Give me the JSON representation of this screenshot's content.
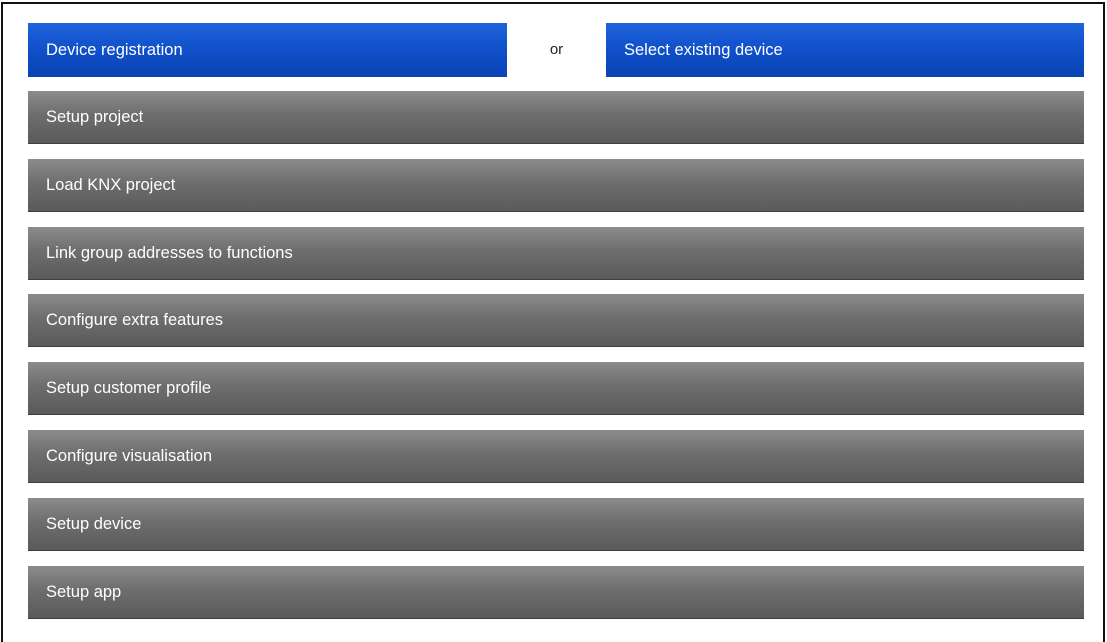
{
  "registration": {
    "device_registration_label": "Device registration",
    "or_label": "or",
    "select_existing_label": "Select existing device",
    "accent_color": "#0f4ec7"
  },
  "steps": [
    {
      "label": "Setup project"
    },
    {
      "label": "Load KNX project"
    },
    {
      "label": "Link group addresses to functions"
    },
    {
      "label": "Configure extra features"
    },
    {
      "label": "Setup customer profile"
    },
    {
      "label": "Configure visualisation"
    },
    {
      "label": "Setup device"
    },
    {
      "label": "Setup app"
    }
  ],
  "colors": {
    "step_bar": "#6e6e6e",
    "text": "#ffffff"
  }
}
